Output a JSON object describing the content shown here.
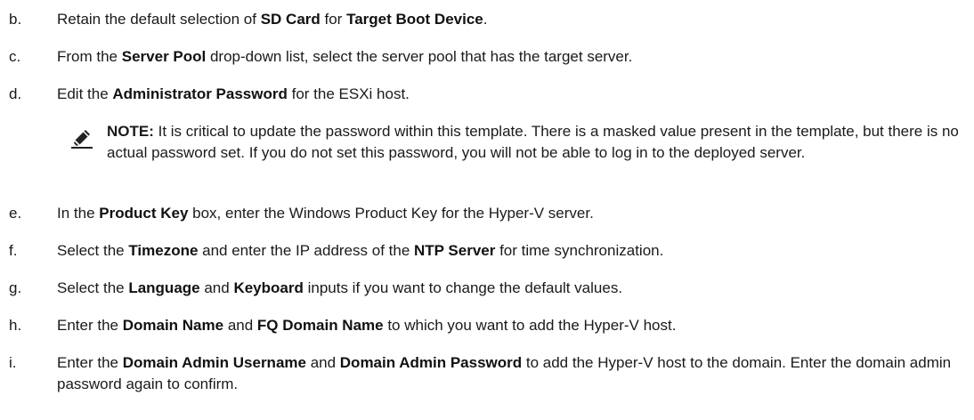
{
  "steps": {
    "b": {
      "marker": "b.",
      "p1": "Retain the default selection of ",
      "b1": "SD Card",
      "p2": " for ",
      "b2": "Target Boot Device",
      "p3": "."
    },
    "c": {
      "marker": "c.",
      "p1": "From the ",
      "b1": "Server Pool",
      "p2": " drop-down list, select the server pool that has the target server."
    },
    "d": {
      "marker": "d.",
      "p1": "Edit the ",
      "b1": "Administrator Password",
      "p2": " for the ESXi host."
    },
    "e": {
      "marker": "e.",
      "p1": "In the ",
      "b1": "Product Key",
      "p2": " box, enter the Windows Product Key for the Hyper-V server."
    },
    "f": {
      "marker": "f.",
      "p1": "Select the ",
      "b1": "Timezone",
      "p2": " and enter the IP address of the ",
      "b2": "NTP Server",
      "p3": " for time synchronization."
    },
    "g": {
      "marker": "g.",
      "p1": "Select the ",
      "b1": "Language",
      "p2": " and ",
      "b2": "Keyboard",
      "p3": " inputs if you want to change the default values."
    },
    "h": {
      "marker": "h.",
      "p1": "Enter the ",
      "b1": "Domain Name",
      "p2": " and ",
      "b2": "FQ Domain Name",
      "p3": " to which you want to add the Hyper-V host."
    },
    "i": {
      "marker": "i.",
      "p1": "Enter the ",
      "b1": "Domain Admin Username",
      "p2": " and ",
      "b2": "Domain Admin Password",
      "p3": " to add the Hyper-V host to the domain. Enter the domain admin password again to confirm."
    }
  },
  "note": {
    "label": "NOTE:",
    "text": " It is critical to update the password within this template. There is a masked value present in the template, but there is no actual password set. If you do not set this password, you will not be able to log in to the deployed server.",
    "icon": "pencil-icon"
  }
}
